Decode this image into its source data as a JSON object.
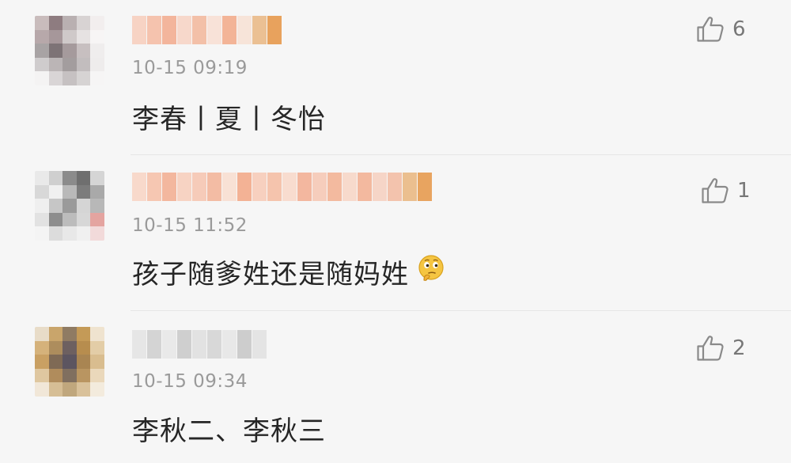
{
  "comments": [
    {
      "time": "10-15 09:19",
      "text": "李春丨夏丨冬怡",
      "likes": "6",
      "avatar_colors": [
        "#c9bcbc",
        "#8e7c80",
        "#b9b0b1",
        "#d8d3d3",
        "#f2eeee",
        "#b7a8aa",
        "#a6979a",
        "#cfc9c9",
        "#e6e2e2",
        "#f7f5f5",
        "#a8a3a4",
        "#7d7376",
        "#a59a9c",
        "#c7bfc0",
        "#efeded",
        "#cfcccd",
        "#bbb5b6",
        "#a39d9e",
        "#c2bdbe",
        "#eeecec",
        "#f4f3f3",
        "#d9d5d6",
        "#c6c1c2",
        "#d6d3d3",
        "#f6f5f5"
      ],
      "name_colors": [
        "#f7d3c4",
        "#f5c3ae",
        "#f3b59c",
        "#f7d8cb",
        "#f3c0a8",
        "#f8e2d8",
        "#f3b497",
        "#f7e4d9",
        "#ebc093",
        "#e8a25d"
      ]
    },
    {
      "time": "10-15 11:52",
      "text": "孩子随爹姓还是随妈姓",
      "likes": "1",
      "avatar_colors": [
        "#e9e9e9",
        "#cfcfcf",
        "#8b8b8b",
        "#6f6f6f",
        "#d5d5d5",
        "#d8d8d8",
        "#f0f0f0",
        "#b9b9b9",
        "#7c7c7c",
        "#a9a9a9",
        "#efefef",
        "#c6c6c6",
        "#9a9a9a",
        "#d5d5d5",
        "#b8b8b8",
        "#e2e2e2",
        "#8d8d8d",
        "#bcbcbc",
        "#d7d7d7",
        "#e4a4a0",
        "#f4f4f4",
        "#dcdcdc",
        "#e8e8e8",
        "#f0f0f0",
        "#f2dada"
      ],
      "name_colors": [
        "#f8d9cb",
        "#f6c7b2",
        "#f3b79e",
        "#f7d3c3",
        "#f6cbb9",
        "#f3bca4",
        "#f8e1d5",
        "#f3b295",
        "#f7d0bf",
        "#f5c4ad",
        "#f8dccf",
        "#f3b79f",
        "#f6cdbc",
        "#f3ba9f",
        "#f7dacc",
        "#f3b99f",
        "#f6d5c7",
        "#f3c3ad",
        "#ebbf8f",
        "#e8a460"
      ]
    },
    {
      "time": "10-15 09:34",
      "text": "李秋二、李秋三",
      "likes": "2",
      "avatar_colors": [
        "#e8dcc8",
        "#c9a56b",
        "#8f7b63",
        "#c49a57",
        "#efe3cf",
        "#d5b27b",
        "#ad8d5d",
        "#6d6060",
        "#b78d4e",
        "#e3cda7",
        "#c9a063",
        "#7f6a55",
        "#5c5560",
        "#a98552",
        "#d9bd8f",
        "#dfc7a0",
        "#b08c5c",
        "#806f5f",
        "#b99561",
        "#ead8bb",
        "#f1e7d8",
        "#d6be95",
        "#c0a77d",
        "#d9c19a",
        "#f3ebdd"
      ],
      "name_colors": [
        "#e6e6e6",
        "#d4d4d4",
        "#e9e9e9",
        "#cfcfcf",
        "#e2e2e2",
        "#d8d8d8",
        "#e8e8e8",
        "#cdcdcd",
        "#e4e4e4"
      ]
    }
  ],
  "icons": {
    "like": "thumbs-up-icon",
    "emoji": "thinking-face-icon"
  },
  "colors": {
    "background": "#f6f6f6",
    "text": "#262626",
    "time": "#9a9a9a",
    "count": "#777777",
    "divider": "#e6e6e6"
  }
}
